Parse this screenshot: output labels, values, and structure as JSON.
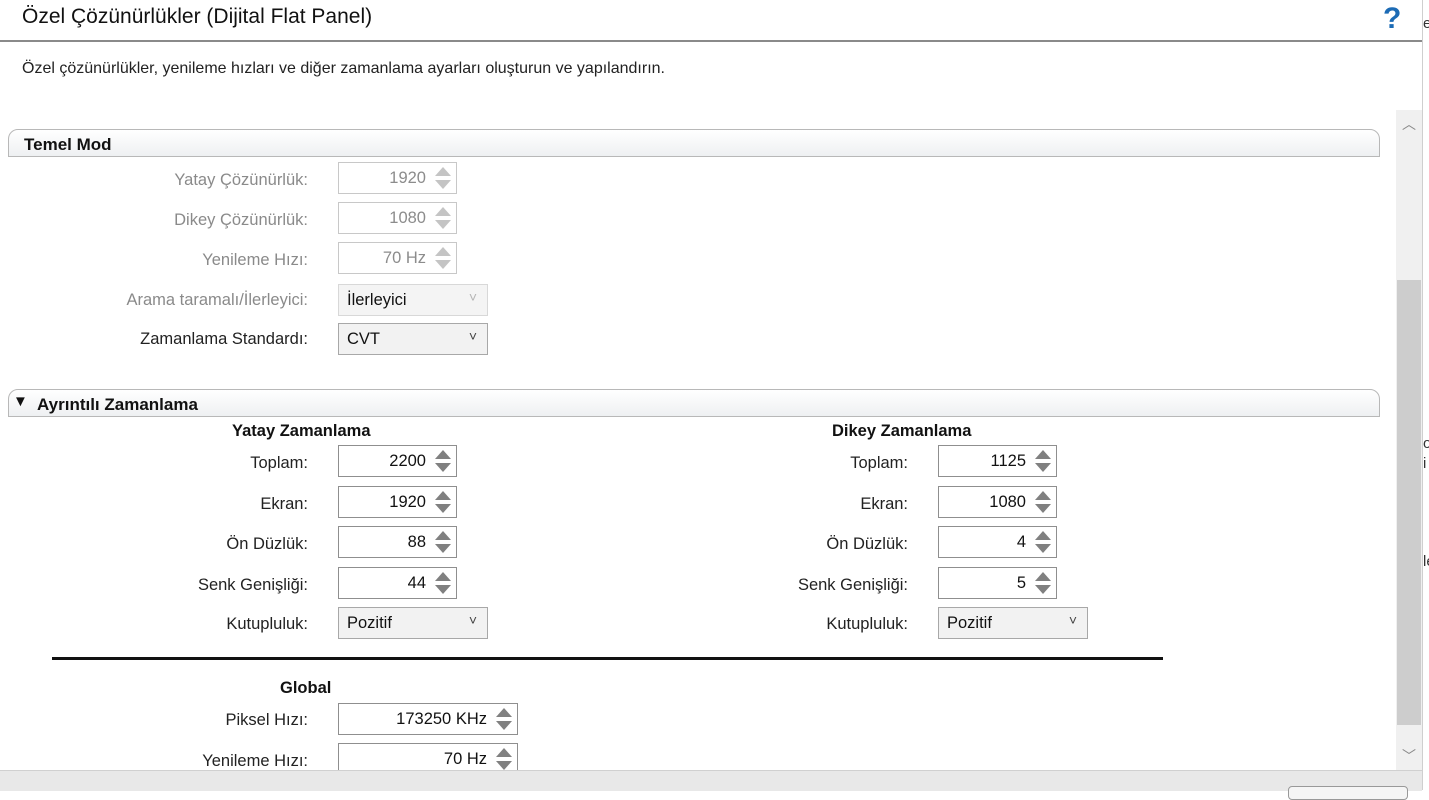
{
  "window": {
    "title": "Özel Çözünürlükler (Dijital Flat Panel)",
    "help_icon": "?"
  },
  "subtitle": "Özel çözünürlükler, yenileme hızları ve diğer zamanlama ayarları oluşturun ve yapılandırın.",
  "basic_mode": {
    "header": "Temel Mod",
    "horizontal_resolution": {
      "label": "Yatay Çözünürlük:",
      "value": "1920"
    },
    "vertical_resolution": {
      "label": "Dikey Çözünürlük:",
      "value": "1080"
    },
    "refresh_rate": {
      "label": "Yenileme Hızı:",
      "value": "70 Hz"
    },
    "scan_type": {
      "label": "Arama taramalı/İlerleyici:",
      "value": "İlerleyici"
    },
    "timing_standard": {
      "label": "Zamanlama Standardı:",
      "value": "CVT"
    }
  },
  "detailed_timing": {
    "header": "Ayrıntılı Zamanlama",
    "collapse_icon": "▼",
    "horizontal": {
      "title": "Yatay Zamanlama",
      "total": {
        "label": "Toplam:",
        "value": "2200"
      },
      "active": {
        "label": "Ekran:",
        "value": "1920"
      },
      "front_porch": {
        "label": "Ön Düzlük:",
        "value": "88"
      },
      "sync_width": {
        "label": "Senk Genişliği:",
        "value": "44"
      },
      "polarity": {
        "label": "Kutupluluk:",
        "value": "Pozitif"
      }
    },
    "vertical": {
      "title": "Dikey Zamanlama",
      "total": {
        "label": "Toplam:",
        "value": "1125"
      },
      "active": {
        "label": "Ekran:",
        "value": "1080"
      },
      "front_porch": {
        "label": "Ön Düzlük:",
        "value": "4"
      },
      "sync_width": {
        "label": "Senk Genişliği:",
        "value": "5"
      },
      "polarity": {
        "label": "Kutupluluk:",
        "value": "Pozitif"
      }
    },
    "global": {
      "title": "Global",
      "pixel_clock": {
        "label": "Piksel Hızı:",
        "value": "173250 KHz"
      },
      "refresh_rate": {
        "label": "Yenileme Hızı:",
        "value": "70 Hz"
      }
    }
  },
  "icons": {
    "dropdown_chevron": "˅",
    "scroll_up": "︿",
    "scroll_down": "﹀"
  },
  "colors": {
    "help_icon": "#1c6bb5",
    "disabled_text": "#8a8a8a"
  },
  "edge_fragments": [
    "e",
    "o",
    "i",
    "le"
  ]
}
